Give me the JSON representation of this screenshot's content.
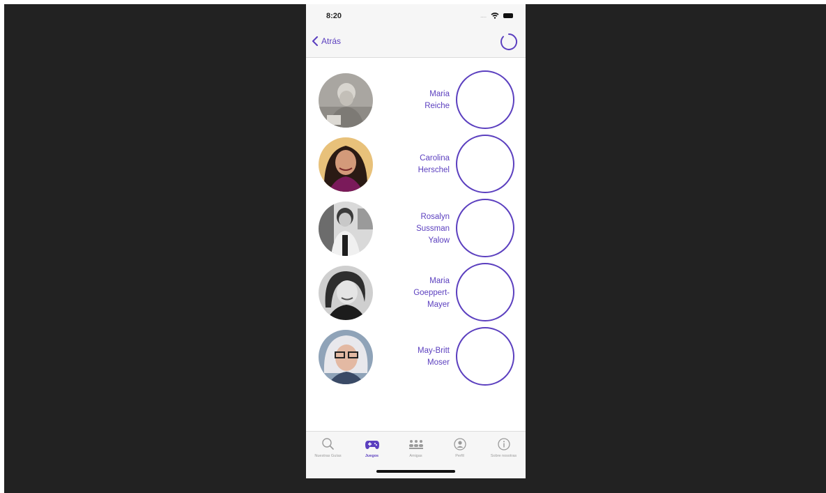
{
  "status_bar": {
    "time": "8:20",
    "signal": "....",
    "icons": [
      "wifi-icon",
      "battery-icon"
    ]
  },
  "nav": {
    "back_label": "Atrás",
    "back_icon": "chevron-left-icon",
    "refresh_icon": "refresh-icon"
  },
  "colors": {
    "accent": "#5b3fbf",
    "bar_background": "#f6f6f6",
    "inactive_tab": "#9a9a9a"
  },
  "scientists": [
    {
      "name_lines": [
        "Maria",
        "Reiche"
      ],
      "photo": "portrait-photo-maria-reiche"
    },
    {
      "name_lines": [
        "Carolina",
        "Herschel"
      ],
      "photo": "portrait-photo-carolina-herschel"
    },
    {
      "name_lines": [
        "Rosalyn",
        "Sussman",
        "Yalow"
      ],
      "photo": "portrait-photo-rosalyn-yalow"
    },
    {
      "name_lines": [
        "Maria",
        "Goeppert-",
        "Mayer"
      ],
      "photo": "portrait-photo-maria-goeppert-mayer"
    },
    {
      "name_lines": [
        "May-Britt",
        "Moser"
      ],
      "photo": "portrait-photo-may-britt-moser"
    }
  ],
  "tabs": [
    {
      "label": "Nuestras Guías",
      "icon": "search-icon",
      "active": false
    },
    {
      "label": "Juegos",
      "icon": "gamepad-icon",
      "active": true
    },
    {
      "label": "Amigas",
      "icon": "people-icon",
      "active": false
    },
    {
      "label": "Perfil",
      "icon": "person-circle-icon",
      "active": false
    },
    {
      "label": "Sobre nosotras",
      "icon": "info-icon",
      "active": false
    }
  ]
}
